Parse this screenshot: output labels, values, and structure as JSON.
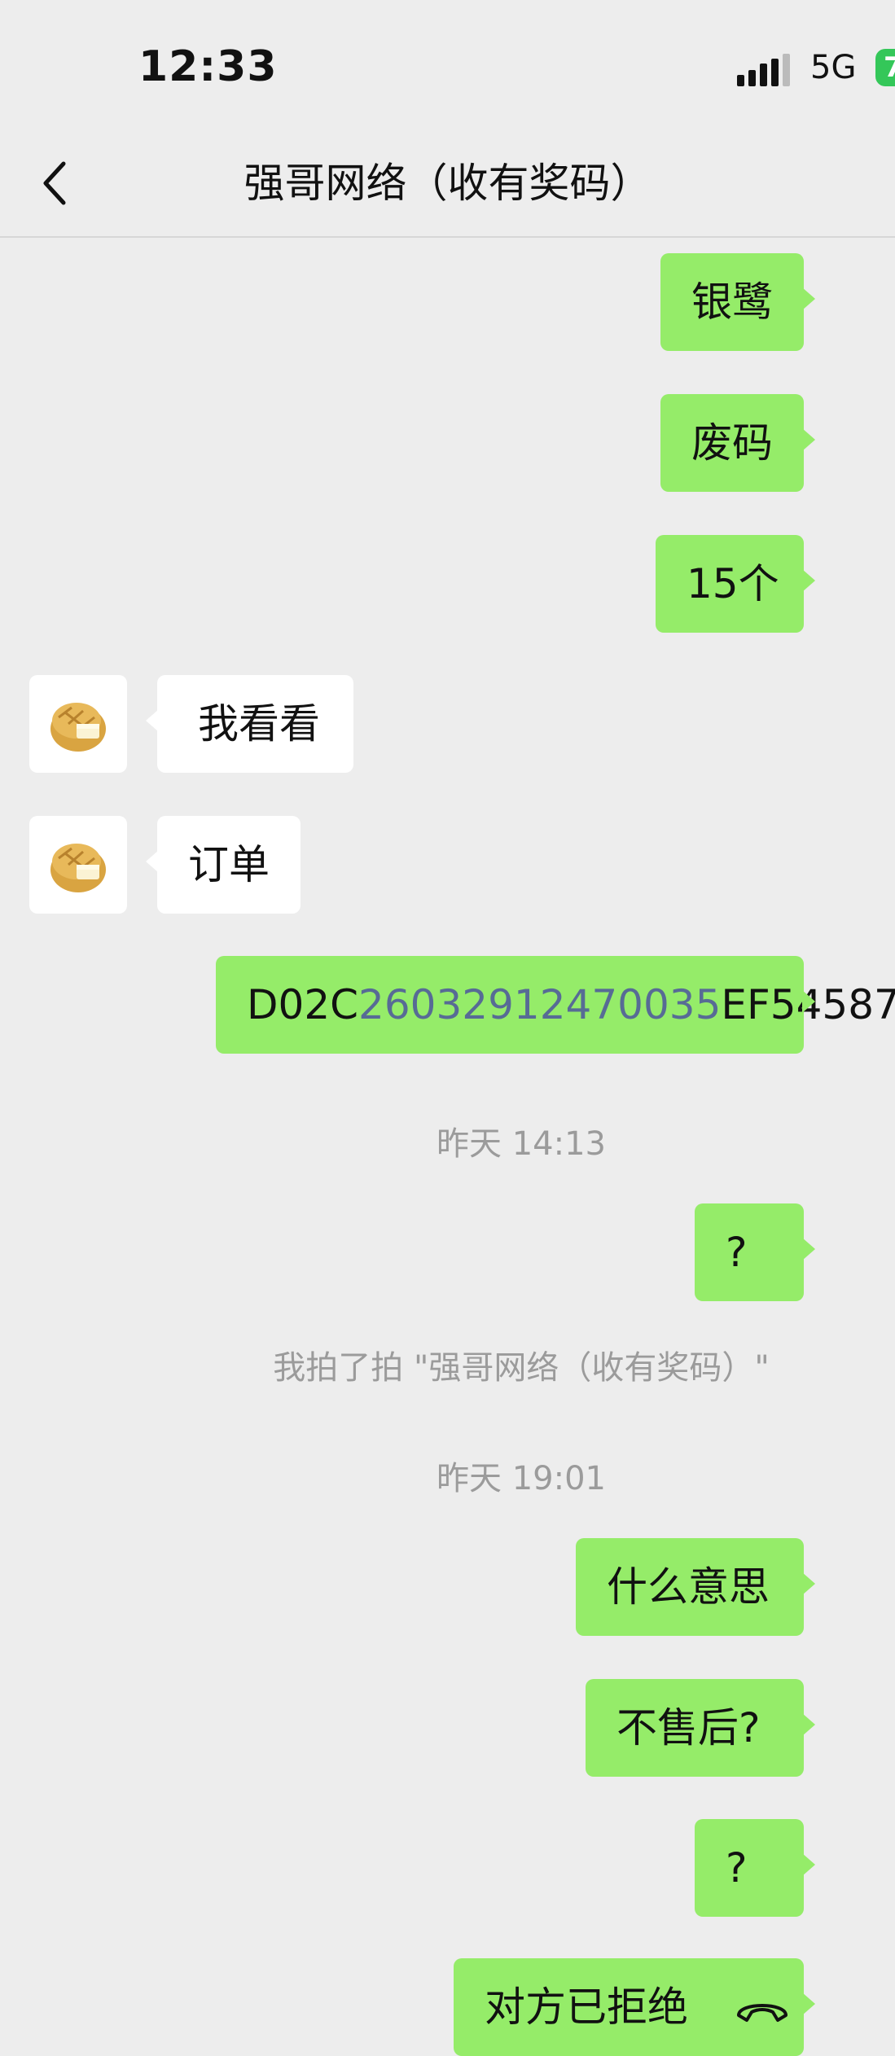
{
  "status_bar": {
    "time": "12:33",
    "network": "5G",
    "battery": "7"
  },
  "header": {
    "title": "强哥网络（收有奖码）"
  },
  "messages": [
    {
      "side": "right",
      "text": "银鹭"
    },
    {
      "side": "right",
      "text": "废码"
    },
    {
      "side": "right",
      "text": "15个"
    },
    {
      "side": "left",
      "text": "我看看"
    },
    {
      "side": "left",
      "text": "订单"
    },
    {
      "side": "right",
      "text_prefix": "D02C",
      "text_link": "26032912470035",
      "text_suffix": "EF54587"
    },
    {
      "type": "timestamp",
      "text": "昨天 14:13"
    },
    {
      "side": "right",
      "text": "?"
    },
    {
      "type": "system",
      "text": "我拍了拍 \"强哥网络（收有奖码）\""
    },
    {
      "type": "timestamp",
      "text": "昨天 19:01"
    },
    {
      "side": "right",
      "text": "什么意思"
    },
    {
      "side": "right",
      "text": "不售后?"
    },
    {
      "side": "right",
      "text": "?"
    },
    {
      "side": "right",
      "text": "对方已拒绝",
      "icon": "phone-hangup-icon"
    }
  ],
  "colors": {
    "background": "#ededed",
    "outgoing_bubble": "#95ec69",
    "incoming_bubble": "#ffffff",
    "link": "#576b95",
    "system_text": "#9b9b9b"
  }
}
